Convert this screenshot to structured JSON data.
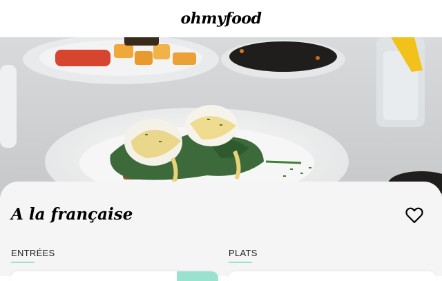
{
  "header": {
    "logo": "ohmyfood"
  },
  "hero": {
    "icon": "food-photo"
  },
  "menu": {
    "title": "A la française",
    "favorite_icon": "heart-outline-icon",
    "sections": [
      {
        "label": "ENTRÉES"
      },
      {
        "label": "PLATS"
      }
    ]
  },
  "colors": {
    "accent": "#99e2d0",
    "card_background": "#f5f5f5",
    "text": "#000000"
  }
}
